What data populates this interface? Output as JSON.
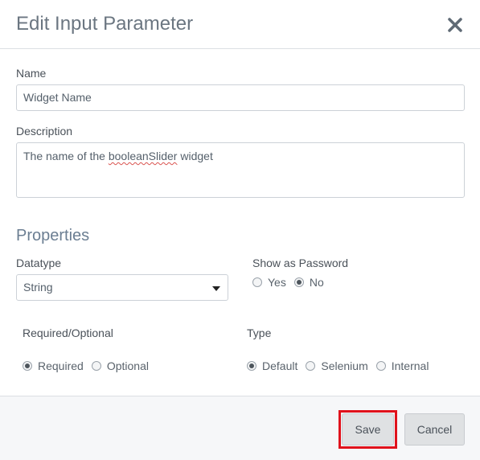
{
  "dialog": {
    "title": "Edit Input Parameter",
    "close_icon": "close-icon"
  },
  "fields": {
    "name_label": "Name",
    "name_value": "Widget Name",
    "description_label": "Description",
    "description_prefix": "The name of the ",
    "description_misspelled": "booleanSlider",
    "description_suffix": " widget"
  },
  "properties": {
    "heading": "Properties",
    "datatype_label": "Datatype",
    "datatype_value": "String",
    "password_label": "Show as Password",
    "password_options": [
      "Yes",
      "No"
    ],
    "password_selected": "No",
    "required_label": "Required/Optional",
    "required_options": [
      "Required",
      "Optional"
    ],
    "required_selected": "Required",
    "type_label": "Type",
    "type_options": [
      "Default",
      "Selenium",
      "Internal"
    ],
    "type_selected": "Default"
  },
  "footer": {
    "save_label": "Save",
    "cancel_label": "Cancel",
    "highlight_color": "#e0121c"
  }
}
